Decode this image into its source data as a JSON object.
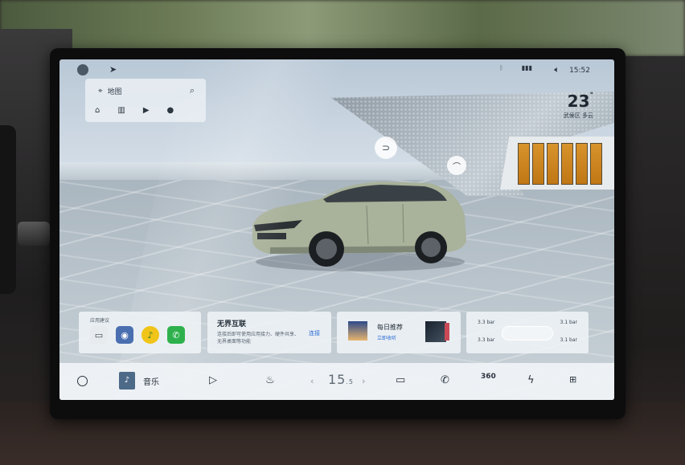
{
  "status_bar": {
    "time": "15:52",
    "icons": [
      "user-avatar-icon",
      "navigation-arrow-icon",
      "bluetooth-icon",
      "signal-icon",
      "volume-icon"
    ]
  },
  "map_widget": {
    "search_label": "地图",
    "shortcuts": [
      "home-icon",
      "office-icon",
      "video-icon",
      "location-icon"
    ]
  },
  "weather": {
    "temperature": "23",
    "degree_symbol": "°",
    "location": "武侯区 多云"
  },
  "cards": {
    "apps": {
      "title": "应用建议",
      "items": [
        "car-app-icon",
        "camera-app-icon",
        "music-app-icon",
        "phone-app-icon"
      ]
    },
    "connect": {
      "title": "无界互联",
      "description": "连接后即可使用应用接力、硬件共享、无界桌面等功能",
      "button_label": "连接"
    },
    "daily": {
      "title": "每日推荐",
      "subtitle": "立即收听"
    },
    "tyre": {
      "front_left": "3.3 bar",
      "front_right": "3.1 bar",
      "rear_left": "3.3 bar",
      "rear_right": "3.1 bar"
    }
  },
  "dock": {
    "music_label": "音乐",
    "temperature": "15",
    "temperature_unit": ".5",
    "icons": [
      "home-circle-icon",
      "music-thumb-icon",
      "play-icon",
      "seat-heat-icon",
      "chevron-left-icon",
      "chevron-right-icon",
      "fan-icon",
      "phone-icon",
      "camera-360-icon",
      "energy-icon",
      "app-grid-icon"
    ],
    "camera_label": "360"
  },
  "colors": {
    "accent_blue": "#2f6fd6",
    "phone_green": "#2eb14d",
    "building_orange": "#d8932c",
    "car_body": "#a9b29a"
  }
}
